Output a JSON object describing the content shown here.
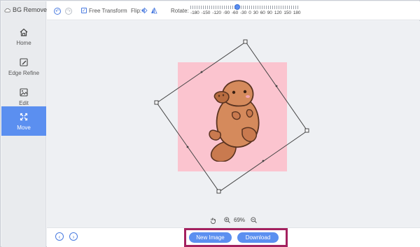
{
  "app": {
    "title": "BG Remover"
  },
  "sidebar": {
    "items": [
      {
        "label": "Home",
        "icon": "home-icon"
      },
      {
        "label": "Edge Refine",
        "icon": "edit-pen-icon"
      },
      {
        "label": "Edit",
        "icon": "image-edit-icon"
      },
      {
        "label": "Move",
        "icon": "move-arrows-icon"
      }
    ],
    "active": "Move"
  },
  "toolbar": {
    "free_transform_label": "Free Transform",
    "free_transform_checked": true,
    "flip_label": "Flip:",
    "rotate_label": "Rotate:",
    "rotate_ticks": [
      "-180",
      "-150",
      "-120",
      "-90",
      "-60",
      "-30",
      "0",
      "30",
      "60",
      "90",
      "120",
      "150",
      "180"
    ],
    "rotate_value_deg": -30
  },
  "zoom": {
    "value": "69%"
  },
  "actions": {
    "new_image": "New Image",
    "download": "Download"
  },
  "colors": {
    "accent": "#5b8ff0",
    "highlight_box": "#a4215f",
    "image_background": "#fbc4cf",
    "platypus_body": "#c97a4f"
  }
}
